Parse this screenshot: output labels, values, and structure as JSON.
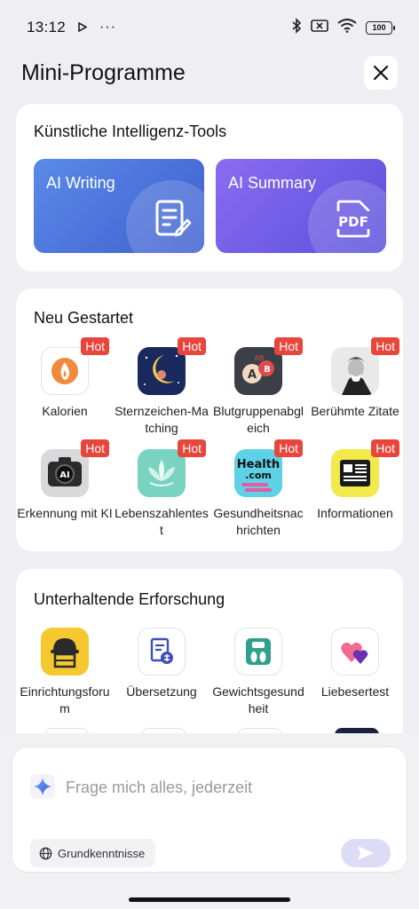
{
  "status_bar": {
    "time": "13:12",
    "battery": "100"
  },
  "header": {
    "title": "Mini-Programme"
  },
  "ai_tools": {
    "title": "Künstliche Intelligenz-Tools",
    "tiles": [
      {
        "label": "AI Writing",
        "icon": "edit-document-icon",
        "color": "#4a73d6"
      },
      {
        "label": "AI Summary",
        "icon": "pdf-icon",
        "color": "#6a5ce6"
      }
    ]
  },
  "new_started": {
    "title": "Neu Gestartet",
    "hot_label": "Hot",
    "apps": [
      {
        "label": "Kalorien",
        "icon": "flame-icon"
      },
      {
        "label": "Sternzeichen-Matching",
        "icon": "moon-zodiac-icon"
      },
      {
        "label": "Blutgruppenabgleich",
        "icon": "blood-type-icon"
      },
      {
        "label": "Berühmte Zitate",
        "icon": "portrait-icon"
      },
      {
        "label": "Erkennung mit KI",
        "icon": "ai-camera-icon"
      },
      {
        "label": "Lebenszahlentest",
        "icon": "lotus-icon"
      },
      {
        "label": "Gesundheitsnachrichten",
        "icon": "health-news-icon"
      },
      {
        "label": "Informationen",
        "icon": "news-info-icon"
      }
    ],
    "app_text_icons": {
      "ai": "AI",
      "health_line1": "Health",
      "health_line2": ".com",
      "blood_a": "A",
      "blood_b": "B",
      "blood_ab": "AB"
    }
  },
  "exploration": {
    "title": "Unterhaltende Erforschung",
    "apps": [
      {
        "label": "Einrichtungsforum",
        "icon": "worker-helmet-icon"
      },
      {
        "label": "Übersetzung",
        "icon": "translate-icon"
      },
      {
        "label": "Gewichtsgesundheit",
        "icon": "scale-icon"
      },
      {
        "label": "Liebesertest",
        "icon": "hearts-icon"
      }
    ]
  },
  "ask": {
    "placeholder": "Frage mich alles, jederzeit",
    "chip_label": "Grundkenntnisse",
    "pdf_text": "PDF"
  },
  "colors": {
    "accent": "#5b6bd8",
    "hot": "#e8463c",
    "background": "#efeff3"
  }
}
